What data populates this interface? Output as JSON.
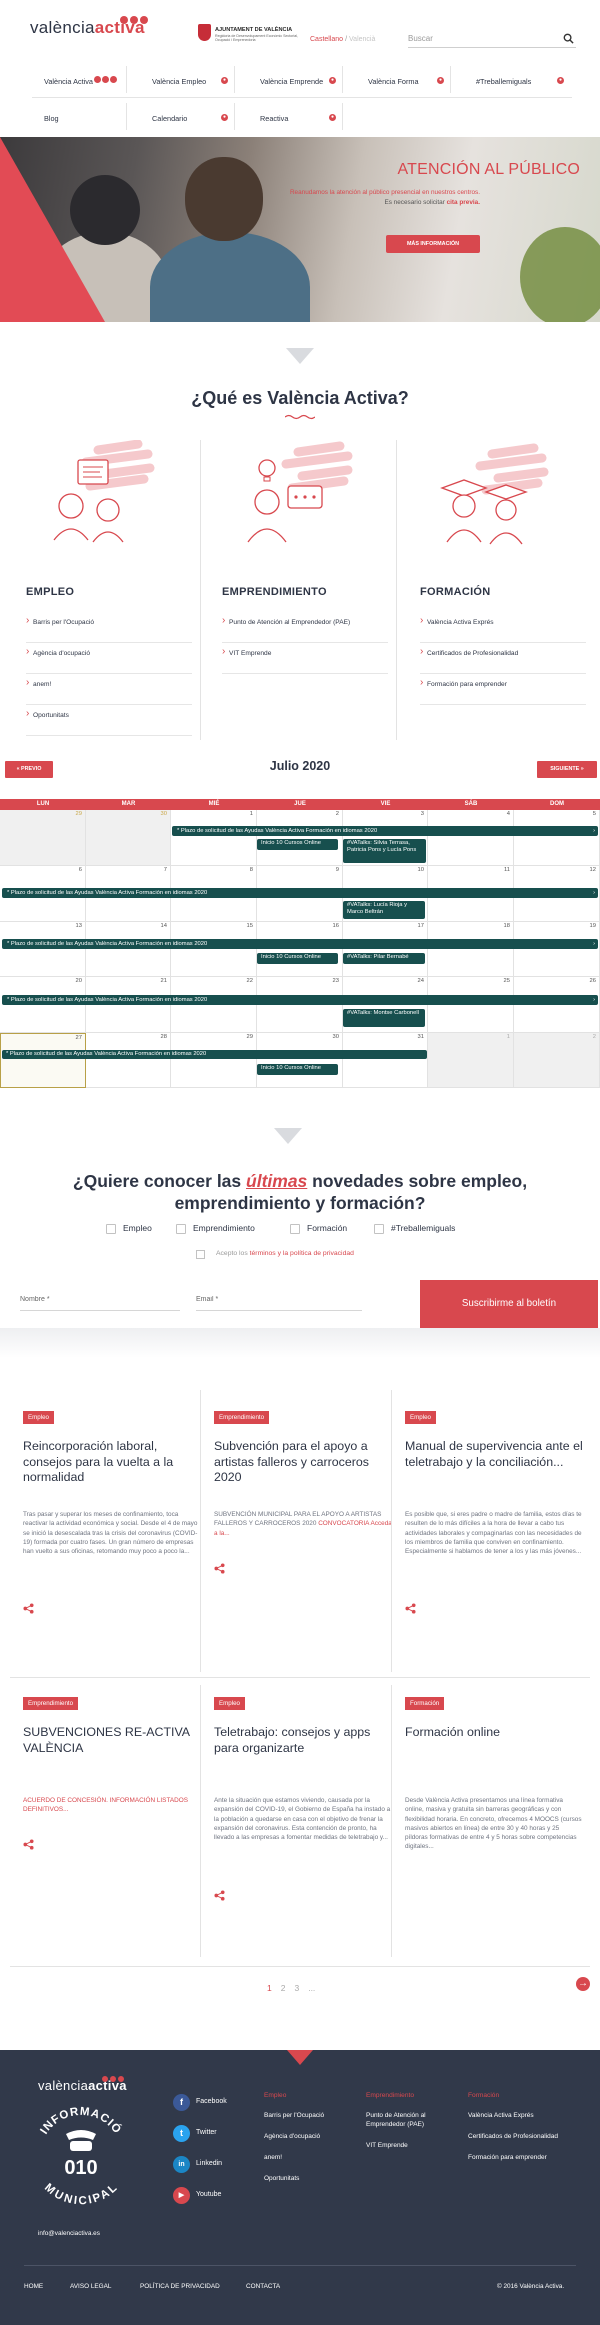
{
  "header": {
    "logo_text_light": "valència",
    "logo_text_bold": "activa",
    "ajuntament_title": "AJUNTAMENT DE VALÈNCIA",
    "ajuntament_sub": "Regidoria de Desenvolupament Econòmic Sectorial, Ocupació i Emprenedoria",
    "lang_current": "Castellano",
    "lang_sep": "/",
    "lang_other": "Valencià",
    "search_placeholder": "Buscar"
  },
  "nav": {
    "items": [
      {
        "label": "València Activa"
      },
      {
        "label": "València Empleo"
      },
      {
        "label": "València Emprende"
      },
      {
        "label": "València Forma"
      },
      {
        "label": "#Treballemiguals"
      },
      {
        "label": "Blog"
      },
      {
        "label": "Calendario"
      },
      {
        "label": "Reactiva"
      }
    ]
  },
  "hero": {
    "title": "ATENCIÓN AL PÚBLICO",
    "line1": "Reanudamos la atención al público presencial en nuestros centros.",
    "line2_prefix": "Es necesario solicitar ",
    "line2_bold": "cita previa.",
    "button": "MÁS INFORMACIÓN",
    "accent_color": "#d8484e"
  },
  "que_es": {
    "title": "¿Qué es València Activa?",
    "pillars": [
      {
        "title": "EMPLEO",
        "links": [
          "Barris per l'Ocupació",
          "Agència d'ocupació",
          "anem!",
          "Oportunitats"
        ]
      },
      {
        "title": "EMPRENDIMIENTO",
        "links": [
          "Punto de Atención al Emprendedor (PAE)",
          "VIT Emprende"
        ]
      },
      {
        "title": "FORMACIÓN",
        "links": [
          "València Activa Exprés",
          "Certificados de Profesionalidad",
          "Formación para emprender"
        ]
      }
    ]
  },
  "calendar": {
    "title": "Julio 2020",
    "prev": "« PREVIO",
    "next": "SIGUIENTE »",
    "weekdays": [
      "LUN",
      "MAR",
      "MIÉ",
      "JUE",
      "VIE",
      "SÁB",
      "DOM"
    ],
    "weeks": [
      [
        "29",
        "30",
        "1",
        "2",
        "3",
        "4",
        "5"
      ],
      [
        "6",
        "7",
        "8",
        "9",
        "10",
        "11",
        "12"
      ],
      [
        "13",
        "14",
        "15",
        "16",
        "17",
        "18",
        "19"
      ],
      [
        "20",
        "21",
        "22",
        "23",
        "24",
        "25",
        "26"
      ],
      [
        "27",
        "28",
        "29",
        "30",
        "31",
        "1",
        "2"
      ]
    ],
    "events": {
      "plazo": "* Plazo de solicitud de las Ayudas València Activa Formación en idiomas 2020",
      "inicio": "Inicio 10 Cursos Online",
      "vatalks1": "#VATalks: Silvia Terrasa, Patricia Pons y Lucía Pons",
      "vatalks2": "#VATalks: Lucía Rioja y Marco Beltrán",
      "vatalks3": "#VATalks: Pilar Bernabé",
      "vatalks4": "#VATalks: Montse Carbonell"
    }
  },
  "newsletter": {
    "title_pre": "¿Quiere conocer las ",
    "title_em": "últimas",
    "title_post": " novedades sobre empleo, emprendimiento y formación?",
    "topics": [
      "Empleo",
      "Emprendimiento",
      "Formación",
      "#Treballemiguals"
    ],
    "privacy_pre": "Acepto los ",
    "privacy_link": "términos y la política de privacidad",
    "name_placeholder": "Nombre *",
    "email_placeholder": "Email *",
    "submit": "Suscribirme al boletín"
  },
  "news": [
    {
      "tag": "Empleo",
      "title": "Reincorporación laboral, consejos para la vuelta a la normalidad",
      "excerpt": "Tras pasar y superar los meses de confinamiento, toca reactivar la actividad económica y social. Desde el 4 de mayo se inició la desescalada tras la crisis del coronavirus (COVID-19) formada por cuatro fases. Un gran número de empresas han vuelto a sus oficinas, retomando muy poco a poco la...",
      "accent": ""
    },
    {
      "tag": "Emprendimiento",
      "title": "Subvención para el apoyo a artistas falleros y carroceros 2020",
      "excerpt": "SUBVENCIÓN MUNICIPAL PARA EL APOYO A ARTISTAS FALLEROS Y CARROCEROS 2020 ",
      "accent": "CONVOCATORIA   Acceda a la..."
    },
    {
      "tag": "Empleo",
      "title": "Manual de supervivencia ante el teletrabajo y la conciliación...",
      "excerpt": "Es posible que, si eres padre o madre de familia, estos días te resulten de lo más difíciles a la hora de llevar a cabo tus actividades laborales y compaginarlas con las necesidades de los miembros de familia que conviven en confinamiento. Especialmente si hablamos de tener a los y las más jóvenes...",
      "accent": ""
    },
    {
      "tag": "Emprendimiento",
      "title": "SUBVENCIONES RE-ACTIVA VALÈNCIA",
      "excerpt": "",
      "accent": "ACUERDO DE CONCESIÓN. INFORMACIÓN LISTADOS DEFINITIVOS..."
    },
    {
      "tag": "Empleo",
      "title": "Teletrabajo: consejos y apps para organizarte",
      "excerpt": "Ante la situación que estamos viviendo, causada por la expansión del COVID-19, el Gobierno de España ha instado a la población a quedarse en casa con el objetivo de frenar la expansión del coronavirus. Esta contención de pronto, ha llevado a las empresas a fomentar medidas de teletrabajo y...",
      "accent": ""
    },
    {
      "tag": "Formación",
      "title": "Formación online",
      "excerpt": "Desde València Activa presentamos una línea formativa online, masiva y gratuita sin barreras geográficas y con flexibilidad horaria. En concreto, ofrecemos 4 MOOCS (cursos masivos abiertos en línea) de entre 30 y 40 horas y 25 píldoras formativas de entre 4 y 5 horas sobre competencias digitales...",
      "accent": ""
    }
  ],
  "pager": {
    "pages": [
      "1",
      "2",
      "3",
      "..."
    ],
    "next": "→"
  },
  "footer": {
    "logo_light": "valència",
    "logo_bold": "activa",
    "badge_top": "INFORMACIÓ",
    "badge_num": "010",
    "badge_bottom": "MUNICIPAL",
    "email": "info@valenciactiva.es",
    "social": [
      "Facebook",
      "Twitter",
      "Linkedin",
      "Youtube"
    ],
    "columns": [
      {
        "title": "Empleo",
        "links": [
          "Barris per l'Ocupació",
          "Agència d'ocupació",
          "anem!",
          "Oportunitats"
        ]
      },
      {
        "title": "Emprendimiento",
        "links": [
          "Punto de Atención al Emprendedor (PAE)",
          "VIT Emprende"
        ]
      },
      {
        "title": "Formación",
        "links": [
          "València Activa Exprés",
          "Certificados de Profesionalidad",
          "Formación para emprender"
        ]
      }
    ],
    "bottom_links": [
      "HOME",
      "AVISO LEGAL",
      "POLÍTICA DE PRIVACIDAD",
      "CONTACTA"
    ],
    "copyright": "© 2016 València Activa."
  }
}
